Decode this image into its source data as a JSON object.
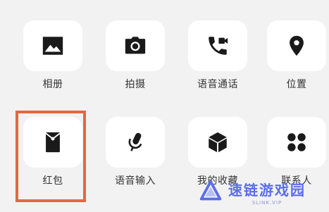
{
  "panel": {
    "items": [
      {
        "label": "相册",
        "icon": "image-icon"
      },
      {
        "label": "拍摄",
        "icon": "camera-icon"
      },
      {
        "label": "语音通话",
        "icon": "phone-video-icon"
      },
      {
        "label": "位置",
        "icon": "location-pin-icon"
      },
      {
        "label": "红包",
        "icon": "red-envelope-icon"
      },
      {
        "label": "语音输入",
        "icon": "microphone-icon"
      },
      {
        "label": "我的收藏",
        "icon": "cube-icon"
      },
      {
        "label": "联系人",
        "icon": "four-dots-icon"
      }
    ]
  },
  "colors": {
    "background": "#f2f2f2",
    "tile": "#ffffff",
    "icon": "#1a1a1a",
    "label": "#333333",
    "highlight": "#e4683d",
    "watermark_main": "#5b6df0",
    "watermark_sub": "#8a93d8"
  },
  "watermark": {
    "main": "速链游戏园",
    "sub": "SLINK.VIP"
  }
}
